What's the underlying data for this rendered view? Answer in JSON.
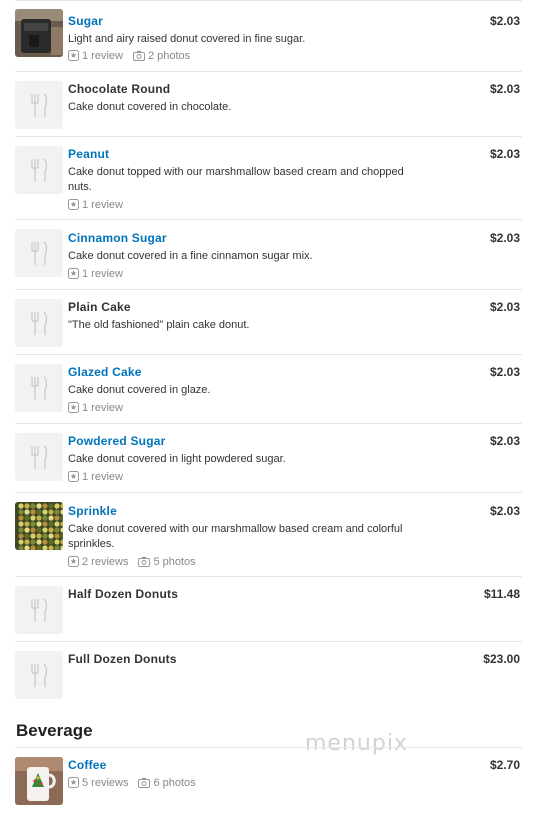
{
  "items": [
    {
      "name": "Sugar",
      "price": "$2.03",
      "desc": "Light and airy raised donut covered in fine sugar.",
      "reviews": "1 review",
      "photos": "2 photos",
      "linked": true,
      "thumb": "photo-sugar"
    },
    {
      "name": "Chocolate Round",
      "price": "$2.03",
      "desc": "Cake donut covered in chocolate.",
      "reviews": "",
      "photos": "",
      "linked": false,
      "thumb": "placeholder"
    },
    {
      "name": "Peanut",
      "price": "$2.03",
      "desc": "Cake donut topped with our marshmallow based cream and chopped nuts.",
      "reviews": "1 review",
      "photos": "",
      "linked": true,
      "thumb": "placeholder"
    },
    {
      "name": "Cinnamon Sugar",
      "price": "$2.03",
      "desc": "Cake donut covered in a fine cinnamon sugar mix.",
      "reviews": "1 review",
      "photos": "",
      "linked": true,
      "thumb": "placeholder"
    },
    {
      "name": "Plain Cake",
      "price": "$2.03",
      "desc": "\"The old fashioned\" plain cake donut.",
      "reviews": "",
      "photos": "",
      "linked": false,
      "thumb": "placeholder"
    },
    {
      "name": "Glazed Cake",
      "price": "$2.03",
      "desc": "Cake donut covered in glaze.",
      "reviews": "1 review",
      "photos": "",
      "linked": true,
      "thumb": "placeholder"
    },
    {
      "name": "Powdered Sugar",
      "price": "$2.03",
      "desc": "Cake donut covered in light powdered sugar.",
      "reviews": "1 review",
      "photos": "",
      "linked": true,
      "thumb": "placeholder"
    },
    {
      "name": "Sprinkle",
      "price": "$2.03",
      "desc": "Cake donut covered with our marshmallow based cream and colorful sprinkles.",
      "reviews": "2 reviews",
      "photos": "5 photos",
      "linked": true,
      "thumb": "photo-sprinkle"
    },
    {
      "name": "Half Dozen Donuts",
      "price": "$11.48",
      "desc": "",
      "reviews": "",
      "photos": "",
      "linked": false,
      "thumb": "placeholder"
    },
    {
      "name": "Full Dozen Donuts",
      "price": "$23.00",
      "desc": "",
      "reviews": "",
      "photos": "",
      "linked": false,
      "thumb": "placeholder"
    }
  ],
  "section": {
    "title": "Beverage"
  },
  "beverage_items": [
    {
      "name": "Coffee",
      "price": "$2.70",
      "desc": "",
      "reviews": "5 reviews",
      "photos": "6 photos",
      "linked": true,
      "thumb": "photo-coffee"
    }
  ],
  "watermark": "menupix",
  "colors": {
    "link": "#0073bb",
    "text": "#333333",
    "meta": "#888888",
    "divider": "#e6e6e6"
  }
}
